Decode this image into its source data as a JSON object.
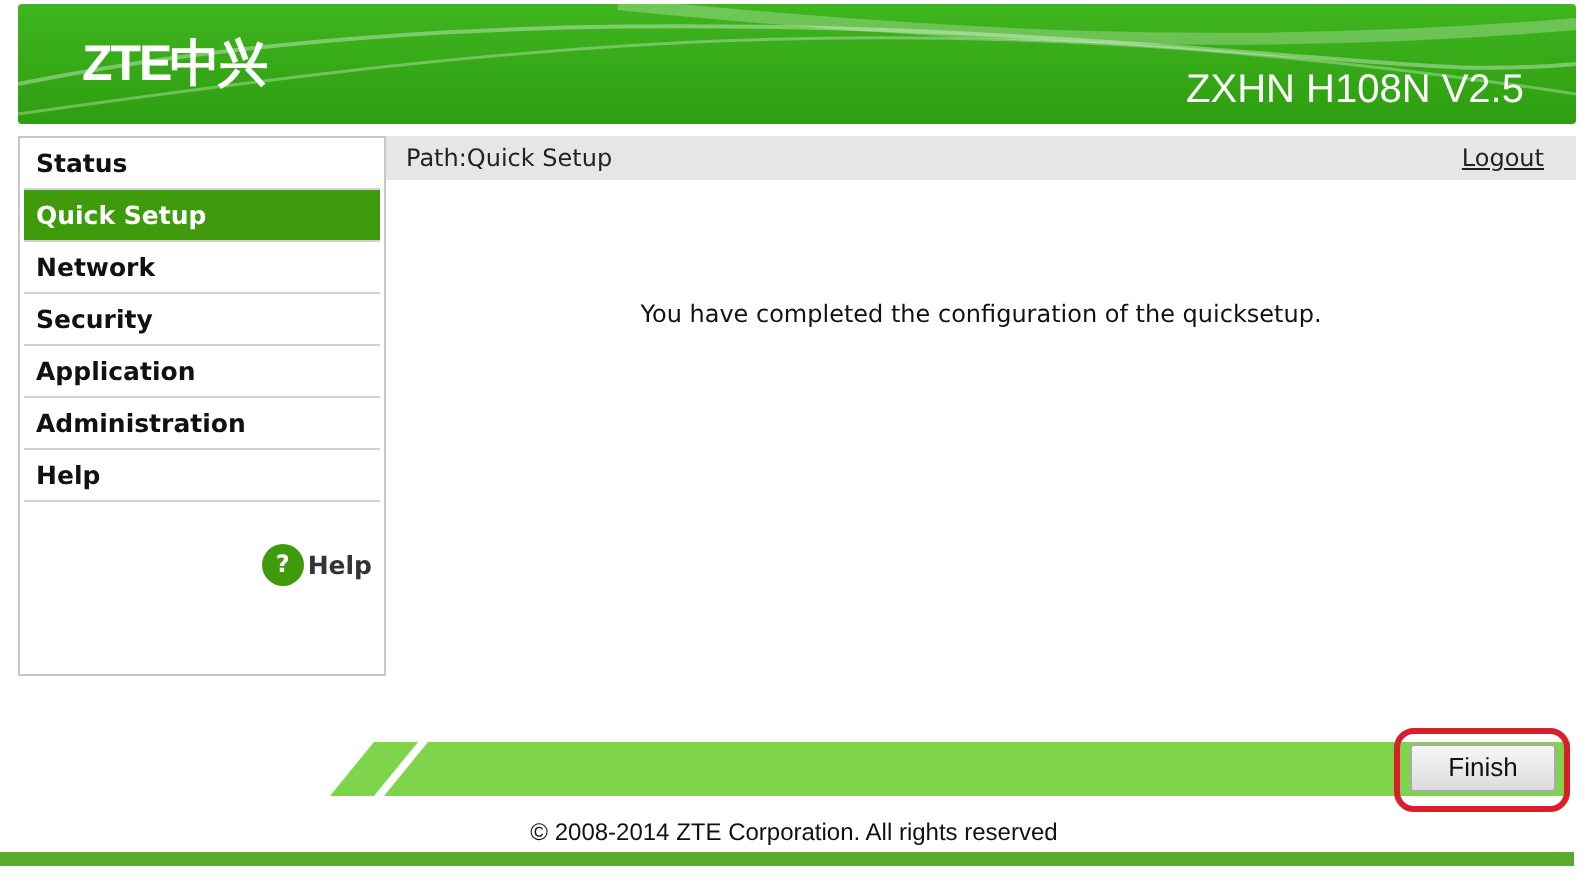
{
  "header": {
    "logo": "ZTE中兴",
    "model": "ZXHN H108N V2.5"
  },
  "sidebar": {
    "items": [
      {
        "label": "Status",
        "selected": false
      },
      {
        "label": "Quick Setup",
        "selected": true
      },
      {
        "label": "Network",
        "selected": false
      },
      {
        "label": "Security",
        "selected": false
      },
      {
        "label": "Application",
        "selected": false
      },
      {
        "label": "Administration",
        "selected": false
      },
      {
        "label": "Help",
        "selected": false
      }
    ],
    "help_link": {
      "icon": "?",
      "label": "Help"
    }
  },
  "path_bar": {
    "path": "Path:Quick Setup",
    "logout": "Logout"
  },
  "message": "You have completed the configuration of the quicksetup.",
  "finish_button": {
    "label": "Finish",
    "highlighted": true
  },
  "footer": "© 2008-2014 ZTE Corporation. All rights reserved"
}
